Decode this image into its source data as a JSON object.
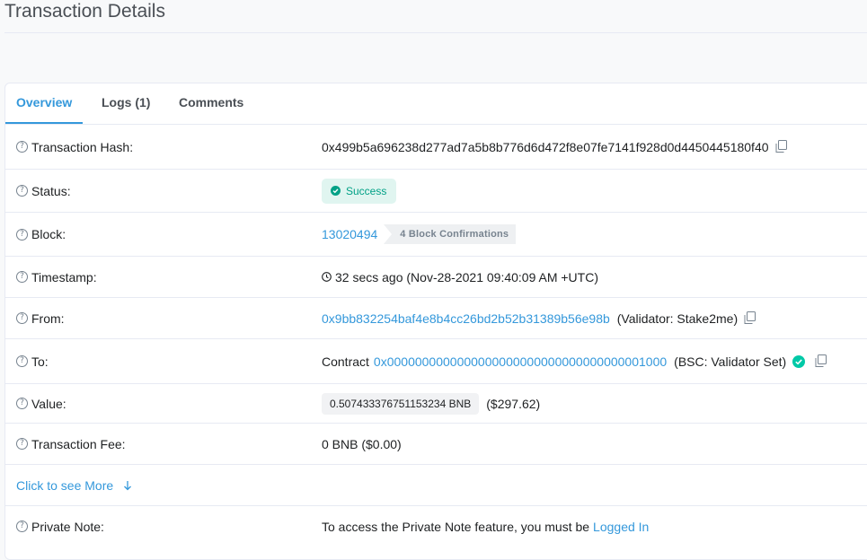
{
  "page": {
    "title": "Transaction Details"
  },
  "tabs": [
    {
      "label": "Overview",
      "active": true
    },
    {
      "label": "Logs (1)",
      "active": false
    },
    {
      "label": "Comments",
      "active": false
    }
  ],
  "rows": {
    "hash": {
      "label": "Transaction Hash:",
      "value": "0x499b5a696238d277ad7a5b8b776d6d472f8e07fe7141f928d0d4450445180f40"
    },
    "status": {
      "label": "Status:",
      "value": "Success"
    },
    "block": {
      "label": "Block:",
      "value": "13020494",
      "confirmations": "4 Block Confirmations"
    },
    "timestamp": {
      "label": "Timestamp:",
      "value": "32 secs ago (Nov-28-2021 09:40:09 AM +UTC)"
    },
    "from": {
      "label": "From:",
      "address": "0x9bb832254baf4e8b4cc26bd2b52b31389b56e98b",
      "note": "(Validator: Stake2me)"
    },
    "to": {
      "label": "To:",
      "prefix": "Contract",
      "address": "0x0000000000000000000000000000000000001000",
      "note": "(BSC: Validator Set)"
    },
    "value": {
      "label": "Value:",
      "amount": "0.507433376751153234 BNB",
      "usd": "($297.62)"
    },
    "fee": {
      "label": "Transaction Fee:",
      "value": "0 BNB ($0.00)"
    },
    "more": {
      "label": "Click to see More"
    },
    "note": {
      "label": "Private Note:",
      "text": "To access the Private Note feature, you must be",
      "link": "Logged In"
    }
  },
  "icons": {
    "help": "question-circle-icon",
    "copy": "copy-icon",
    "check": "check-circle-icon",
    "clock": "clock-icon",
    "verified": "verified-check-icon",
    "arrow": "arrow-down-icon"
  },
  "colors": {
    "accent": "#3498db",
    "success": "#00a186",
    "success_bg": "#e0f5f0",
    "verified": "#00c9a7"
  }
}
